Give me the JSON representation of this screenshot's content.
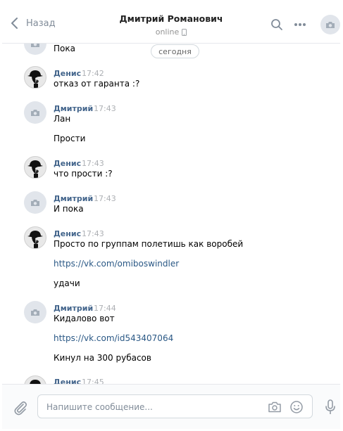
{
  "header": {
    "back_label": "Назад",
    "title": "Дмитрий Романович",
    "status": "online"
  },
  "date_separator": "сегодня",
  "messages": [
    {
      "avatar": "camera-icon",
      "author": "",
      "time": "",
      "lines": [
        "Пока"
      ]
    },
    {
      "avatar": "hat-avatar",
      "author": "Денис",
      "time": "17:42",
      "lines": [
        "отказ от гаранта :?"
      ]
    },
    {
      "avatar": "camera-icon",
      "author": "Дмитрий",
      "time": "17:43",
      "lines": [
        "Лан",
        "Прости"
      ]
    },
    {
      "avatar": "hat-avatar",
      "author": "Денис",
      "time": "17:43",
      "lines": [
        "что прости :?"
      ]
    },
    {
      "avatar": "camera-icon",
      "author": "Дмитрий",
      "time": "17:43",
      "lines": [
        "И пока"
      ]
    },
    {
      "avatar": "hat-avatar",
      "author": "Денис",
      "time": "17:43",
      "lines": [
        "Просто по группам полетишь как воробей",
        "https://vk.com/omiboswindler",
        "удачи"
      ]
    },
    {
      "avatar": "camera-icon",
      "author": "Дмитрий",
      "time": "17:44",
      "lines": [
        "Кидалово вот",
        "https://vk.com/id543407064",
        "Кинул на 300 рубасов"
      ]
    },
    {
      "avatar": "hat-avatar",
      "author": "Денис",
      "time": "17:45",
      "lines": []
    }
  ],
  "composer": {
    "placeholder": "Напишите сообщение..."
  },
  "colors": {
    "author": "#42648b",
    "link": "#2a5885",
    "muted": "#818c99",
    "avatar_bg": "#e1e5eb"
  }
}
